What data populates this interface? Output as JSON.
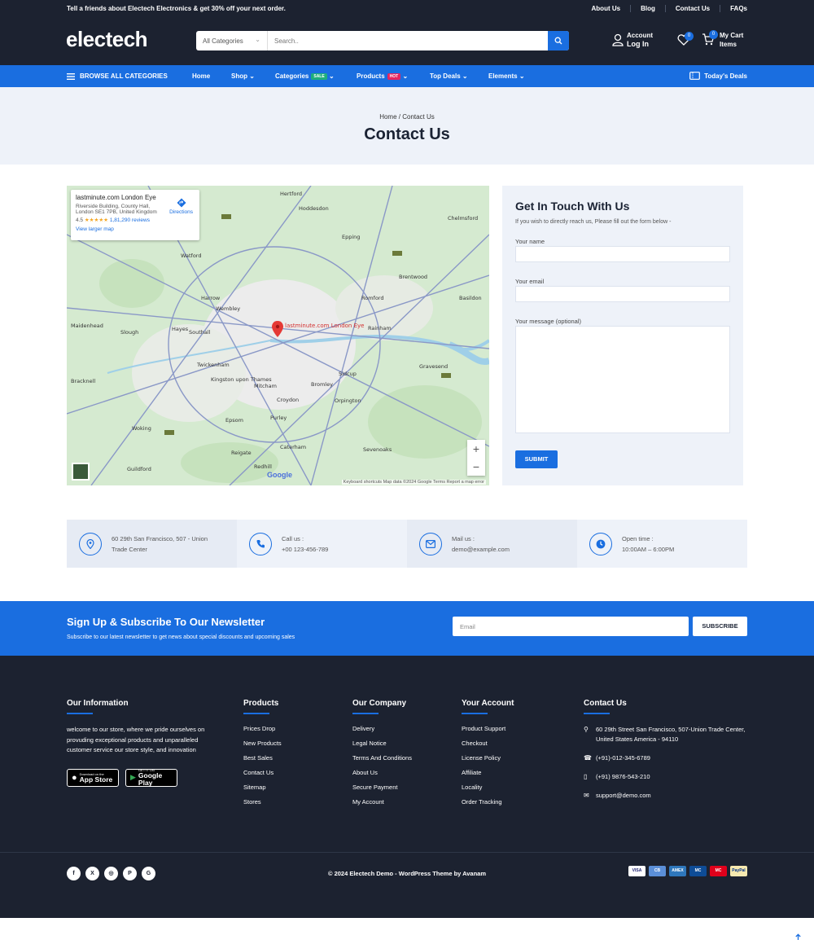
{
  "topbar": {
    "promo": "Tell a friends about Electech Electronics & get 30% off your next order.",
    "links": [
      "About Us",
      "Blog",
      "Contact Us",
      "FAQs"
    ]
  },
  "header": {
    "logo": "electech",
    "category_select": "All Categories",
    "search_placeholder": "Search..",
    "account_line1": "Account",
    "account_line2": "Log In",
    "wishlist_count": "0",
    "cart_count": "0",
    "cart_line1": "My Cart",
    "cart_line2": "Items"
  },
  "nav": {
    "browse": "BROWSE ALL CATEGORIES",
    "home": "Home",
    "shop": "Shop",
    "categories": "Categories",
    "categories_tag": "SALE",
    "products": "Products",
    "products_tag": "HOT",
    "top_deals": "Top Deals",
    "elements": "Elements",
    "todays_deals": "Today's Deals"
  },
  "hero": {
    "breadcrumb": "Home / Contact Us",
    "title": "Contact Us"
  },
  "map": {
    "place_name": "lastminute.com London Eye",
    "address_line1": "Riverside Building, County Hall,",
    "address_line2": "London SE1 7PB, United Kingdom",
    "rating": "4.5",
    "stars": "★★★★★",
    "reviews": "1,81,290 reviews",
    "larger_map": "View larger map",
    "directions": "Directions",
    "pin_label": "lastminute.com London Eye",
    "footer": "Keyboard shortcuts   Map data ©2024 Google   Terms   Report a map error",
    "google": "Google",
    "places": [
      {
        "name": "Hertford"
      },
      {
        "name": "Hoddesdon"
      },
      {
        "name": "Chelmsford"
      },
      {
        "name": "Watford"
      },
      {
        "name": "Epping"
      },
      {
        "name": "Brentwood"
      },
      {
        "name": "Harrow"
      },
      {
        "name": "Wembley"
      },
      {
        "name": "Romford"
      },
      {
        "name": "Basildon"
      },
      {
        "name": "Slough"
      },
      {
        "name": "Southall"
      },
      {
        "name": "Rainham"
      },
      {
        "name": "Twickenham"
      },
      {
        "name": "Kingston upon Thames"
      },
      {
        "name": "Bromley"
      },
      {
        "name": "Sidcup"
      },
      {
        "name": "Gravesend"
      },
      {
        "name": "Croydon"
      },
      {
        "name": "Orpington"
      },
      {
        "name": "Epsom"
      },
      {
        "name": "Woking"
      },
      {
        "name": "Caterham"
      },
      {
        "name": "Sevenoaks"
      },
      {
        "name": "Guildford"
      },
      {
        "name": "Redhill"
      },
      {
        "name": "Reigate"
      },
      {
        "name": "Maidenhead"
      },
      {
        "name": "Bracknell"
      },
      {
        "name": "Hayes"
      },
      {
        "name": "Mitcham"
      },
      {
        "name": "Purley"
      }
    ]
  },
  "form": {
    "title": "Get In Touch With Us",
    "subtitle": "If you wish to directly reach us, Please fill out the form below -",
    "name_label": "Your name",
    "email_label": "Your email",
    "message_label": "Your message (optional)",
    "submit": "SUBMIT"
  },
  "info": [
    {
      "icon": "map-pin-icon",
      "line1": "60 29th San Francisco, 507 - Union",
      "line2": "Trade Center"
    },
    {
      "icon": "phone-icon",
      "line1": "Call us :",
      "line2": "+00 123-456-789"
    },
    {
      "icon": "mail-icon",
      "line1": "Mail us :",
      "line2": "demo@example.com"
    },
    {
      "icon": "clock-icon",
      "line1": "Open time :",
      "line2": "10:00AM – 6:00PM"
    }
  ],
  "newsletter": {
    "title": "Sign Up & Subscribe To Our Newsletter",
    "subtitle": "Subscribe to our latest newsletter to get news about special discounts and upcoming sales",
    "placeholder": "Email",
    "button": "SUBSCRIBE"
  },
  "footer": {
    "info_title": "Our Information",
    "info_desc": "welcome to our store, where we pride ourselves on provuding exceptional products and unparalleled customer service our store style, and innovation",
    "app_store_small": "Download on the",
    "app_store": "App Store",
    "google_play_small": "GET IT ON",
    "google_play": "Google Play",
    "products_title": "Products",
    "products": [
      "Prices Drop",
      "New Products",
      "Best Sales",
      "Contact Us",
      "Sitemap",
      "Stores"
    ],
    "company_title": "Our Company",
    "company": [
      "Delivery",
      "Legal Notice",
      "Terms And Conditions",
      "About Us",
      "Secure Payment",
      "My Account"
    ],
    "account_title": "Your Account",
    "account": [
      "Product Support",
      "Checkout",
      "License Policy",
      "Affiliate",
      "Locality",
      "Order Tracking"
    ],
    "contact_title": "Contact Us",
    "contact_address": "60 29th Street San Francisco, 507-Union Trade Center, United States America - 94110",
    "contact_phone1": "(+91)-012-345-6789",
    "contact_phone2": "(+91) 9876-543-210",
    "contact_email": "support@demo.com",
    "social": [
      "f",
      "X",
      "◎",
      "P",
      "G"
    ],
    "copyright": "© 2024 Electech Demo - WordPress Theme by Avanam",
    "payments": [
      "VISA",
      "CB",
      "AMEX",
      "MC",
      "MC",
      "PayPal"
    ]
  },
  "colors": {
    "brand": "#1a6ee0",
    "dark": "#1c2230",
    "light": "#eef2f9"
  }
}
